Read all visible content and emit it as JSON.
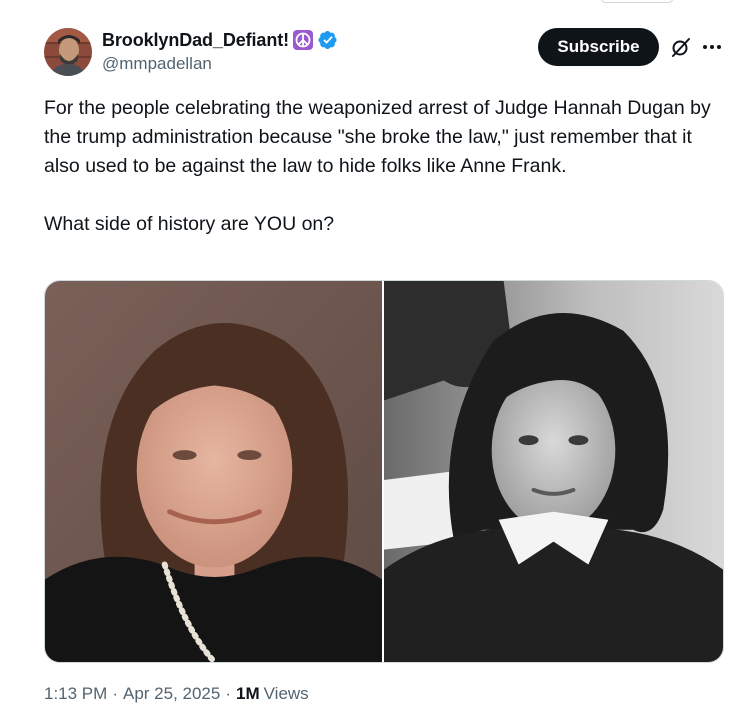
{
  "author": {
    "display_name": "BrooklynDad_Defiant!",
    "handle": "@mmpadellan",
    "badges": [
      "peace-emoji",
      "verified-badge"
    ]
  },
  "actions": {
    "subscribe_label": "Subscribe",
    "icons": [
      "grok-icon",
      "more-icon"
    ]
  },
  "tweet": {
    "paragraph_1": "For the people celebrating the weaponized arrest of Judge Hannah Dugan by the trump administration because \"she broke the law,\" just remember that it also used to be against the law to hide folks like Anne Frank.",
    "paragraph_2": "What side of history are YOU on?"
  },
  "meta": {
    "time": "1:13 PM",
    "separator": "·",
    "date": "Apr 25, 2025",
    "views_count": "1M",
    "views_label": "Views"
  },
  "colors": {
    "text": "#0f1419",
    "secondary": "#536471",
    "verified": "#1d9bf0",
    "peace": "#9b59d0",
    "border": "#cfd9de",
    "button_bg": "#0f1419"
  }
}
